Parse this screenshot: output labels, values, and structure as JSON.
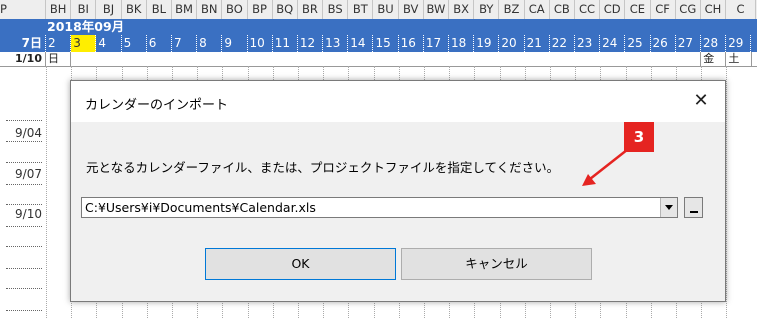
{
  "sheet": {
    "corner_label": "P",
    "columns": [
      "BH",
      "BI",
      "BJ",
      "BK",
      "BL",
      "BM",
      "BN",
      "BO",
      "BP",
      "BQ",
      "BR",
      "BS",
      "BT",
      "BU",
      "BV",
      "BW",
      "BX",
      "BY",
      "BZ",
      "CA",
      "CB",
      "CC",
      "CD",
      "CE",
      "CF",
      "CG",
      "CH",
      "C"
    ],
    "month_label": "2018年09月",
    "lead_day_label": "7日",
    "days": [
      "2",
      "3",
      "4",
      "5",
      "6",
      "7",
      "8",
      "9",
      "10",
      "11",
      "12",
      "13",
      "14",
      "15",
      "16",
      "17",
      "18",
      "19",
      "20",
      "21",
      "22",
      "23",
      "24",
      "25",
      "26",
      "27",
      "28",
      "29"
    ],
    "today_day": "3",
    "lead_week_label": "1/10",
    "weekday_first": "日",
    "weekday_last_visible": [
      "金",
      "土"
    ],
    "row_labels": [
      "9/04",
      "9/07",
      "9/10"
    ]
  },
  "dialog": {
    "title": "カレンダーのインポート",
    "close_glyph": "✕",
    "prompt": "元となるカレンダーファイル、または、プロジェクトファイルを指定してください。",
    "path_value": "C:¥Users¥i¥Documents¥Calendar.xls",
    "ok_label": "OK",
    "cancel_label": "キャンセル"
  },
  "callout": {
    "number": "3",
    "color": "#e52421"
  },
  "colors": {
    "header_blue": "#3a70c2",
    "today_yellow": "#ffee00",
    "dialog_body": "#f0f0f0"
  }
}
